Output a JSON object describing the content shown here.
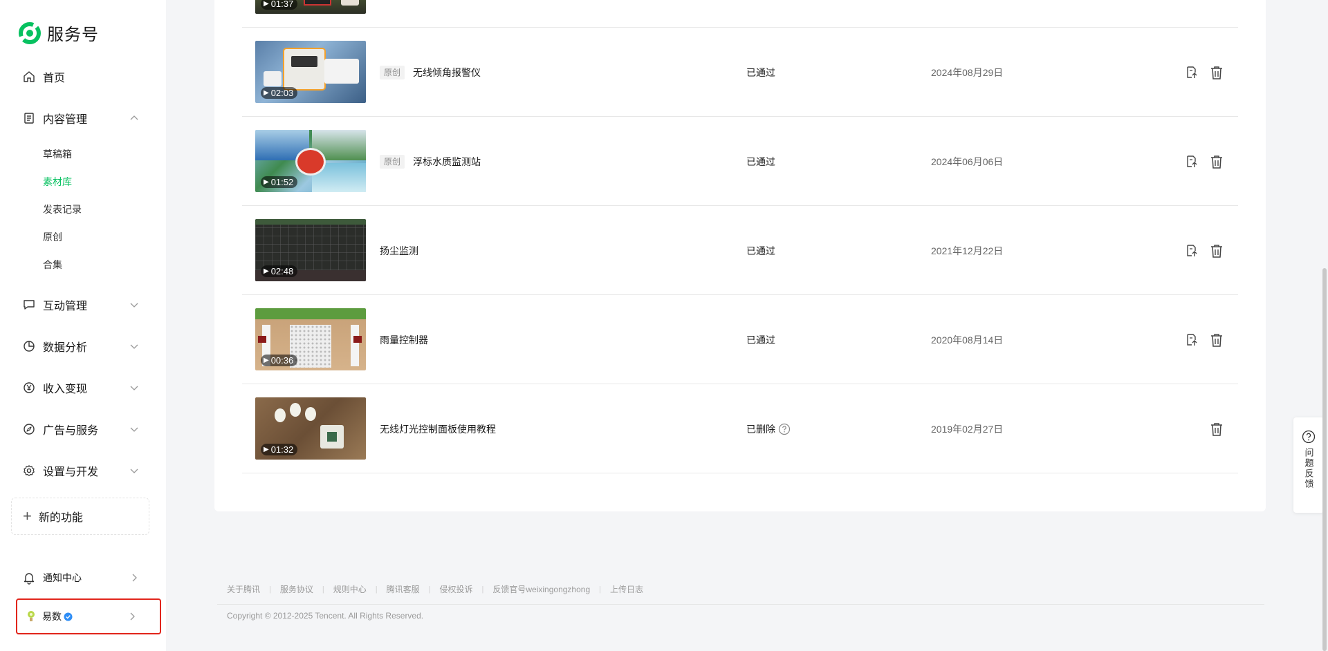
{
  "app": {
    "title": "服务号"
  },
  "sidebar": {
    "items": [
      {
        "label": "首页",
        "icon": "home-icon"
      },
      {
        "label": "内容管理",
        "icon": "document-icon",
        "expanded": true,
        "children": [
          {
            "label": "草稿箱"
          },
          {
            "label": "素材库",
            "active": true
          },
          {
            "label": "发表记录"
          },
          {
            "label": "原创"
          },
          {
            "label": "合集"
          }
        ]
      },
      {
        "label": "互动管理",
        "icon": "chat-icon"
      },
      {
        "label": "数据分析",
        "icon": "pie-icon"
      },
      {
        "label": "收入变现",
        "icon": "yen-icon"
      },
      {
        "label": "广告与服务",
        "icon": "compass-icon"
      },
      {
        "label": "设置与开发",
        "icon": "gear-icon"
      }
    ],
    "new_feature": "新的功能",
    "notify": "通知中心",
    "account": "易数"
  },
  "rows": [
    {
      "duration": "01:37"
    },
    {
      "duration": "02:03",
      "badge": "原创",
      "title": "无线倾角报警仪",
      "status": "已通过",
      "date": "2024年08月29日",
      "editable": true
    },
    {
      "duration": "01:52",
      "badge": "原创",
      "title": "浮标水质监测站",
      "status": "已通过",
      "date": "2024年06月06日",
      "editable": true
    },
    {
      "duration": "02:48",
      "title": "扬尘监测",
      "status": "已通过",
      "date": "2021年12月22日",
      "editable": true
    },
    {
      "duration": "00:36",
      "title": "雨量控制器",
      "status": "已通过",
      "date": "2020年08月14日",
      "editable": true
    },
    {
      "duration": "01:32",
      "title": "无线灯光控制面板使用教程",
      "status": "已删除",
      "date": "2019年02月27日",
      "editable": false
    }
  ],
  "footer": {
    "links": [
      "关于腾讯",
      "服务协议",
      "规则中心",
      "腾讯客服",
      "侵权投诉",
      "反馈官号weixingongzhong",
      "上传日志"
    ],
    "copyright": "Copyright © 2012-2025 Tencent. All Rights Reserved."
  },
  "feedback": {
    "label": "问题反馈"
  },
  "colors": {
    "accent": "#07c160",
    "highlight_border": "#e1251b"
  }
}
